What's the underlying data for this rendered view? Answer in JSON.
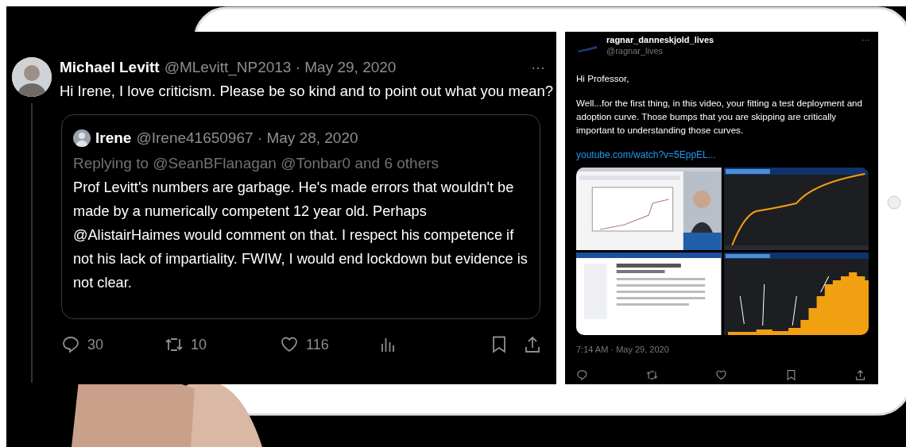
{
  "left_tweet": {
    "name": "Michael Levitt",
    "meta": "@MLevitt_NP2013 · May 29, 2020",
    "more": "···",
    "text": "Hi Irene, I love criticism. Please be so kind and to point out what you mean?",
    "quoted": {
      "name": "Irene",
      "meta": "@Irene41650967 · May 28, 2020",
      "replying_to": "Replying to @SeanBFlanagan @Tonbar0 and 6 others",
      "text": "Prof Levitt's numbers are garbage.  He's made errors that wouldn't be made by a numerically competent 12 year old. Perhaps @AlistairHaimes would comment  on that. I respect his competence if not his lack of impartiality.  FWIW, I would end lockdown but evidence is not clear."
    },
    "actions": [
      {
        "kind": "reply",
        "count": "30"
      },
      {
        "kind": "retweet",
        "count": "10"
      },
      {
        "kind": "like",
        "count": "116"
      },
      {
        "kind": "views"
      },
      {
        "kind": "bookmark"
      },
      {
        "kind": "share"
      }
    ]
  },
  "right_tweet": {
    "name": "ragnar_danneskjold_lives",
    "handle": "@ragnar_lives",
    "more": "···",
    "paragraphs": [
      "Hi Professor,",
      "Well...for the first thing, in this video, your fitting a test deployment and adoption curve.  Those bumps that you are skipping are critically important to understanding those curves."
    ],
    "link": "youtube.com/watch?v=5EppEL...",
    "timestamp": "7:14 AM · May 29, 2020",
    "actions": [
      {
        "kind": "reply"
      },
      {
        "kind": "retweet"
      },
      {
        "kind": "like"
      },
      {
        "kind": "bookmark"
      },
      {
        "kind": "share"
      }
    ]
  }
}
